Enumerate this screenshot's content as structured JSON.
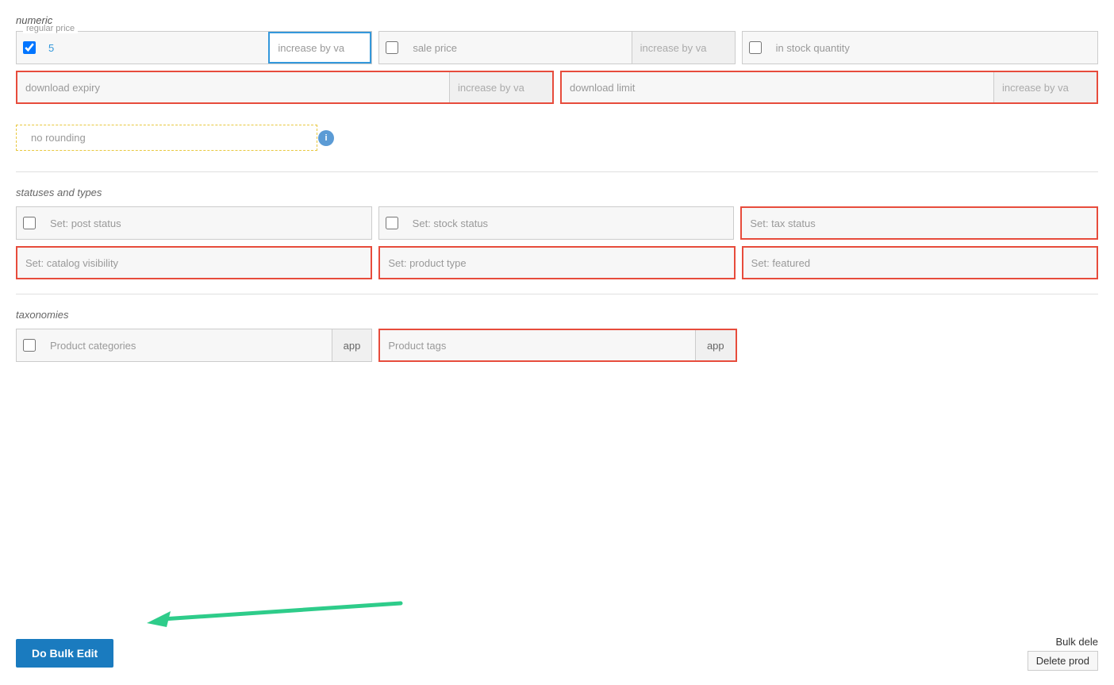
{
  "sections": {
    "numeric": {
      "label": "numeric",
      "rows": [
        {
          "cells": [
            {
              "id": "regular-price",
              "border": "normal",
              "hasCheckbox": true,
              "checked": true,
              "fieldLabel": "regular price",
              "inputValue": "5",
              "secondaryPlaceholder": "increase by va",
              "secondaryBlueBorder": true
            },
            {
              "id": "sale-price",
              "border": "normal",
              "hasCheckbox": true,
              "checked": false,
              "fieldLabel": "sale price",
              "inputValue": "",
              "secondaryPlaceholder": "increase by va",
              "secondaryBlueBorder": false
            },
            {
              "id": "in-stock-quantity",
              "border": "normal",
              "hasCheckbox": true,
              "checked": false,
              "fieldLabel": "in stock quantity",
              "inputValue": "",
              "secondaryPlaceholder": "",
              "secondaryBlueBorder": false,
              "noSecondary": true
            }
          ]
        },
        {
          "cells": [
            {
              "id": "download-expiry",
              "border": "red",
              "hasCheckbox": false,
              "fieldLabel": "download expiry",
              "secondaryPlaceholder": "increase by va"
            },
            {
              "id": "download-limit",
              "border": "red",
              "hasCheckbox": false,
              "fieldLabel": "download limit",
              "secondaryPlaceholder": "increase by va"
            }
          ]
        }
      ],
      "rounding": {
        "label": "no rounding",
        "infoIcon": "i"
      }
    },
    "statuses": {
      "label": "statuses and types",
      "rows": [
        {
          "cells": [
            {
              "id": "post-status",
              "border": "normal",
              "hasCheckbox": true,
              "checked": false,
              "fieldLabel": "Set: post status"
            },
            {
              "id": "stock-status",
              "border": "normal",
              "hasCheckbox": true,
              "checked": false,
              "fieldLabel": "Set: stock status"
            },
            {
              "id": "tax-status",
              "border": "red",
              "hasCheckbox": false,
              "fieldLabel": "Set: tax status"
            }
          ]
        },
        {
          "cells": [
            {
              "id": "catalog-visibility",
              "border": "red",
              "hasCheckbox": false,
              "fieldLabel": "Set: catalog visibility"
            },
            {
              "id": "product-type",
              "border": "red",
              "hasCheckbox": false,
              "fieldLabel": "Set: product type"
            },
            {
              "id": "set-featured",
              "border": "red",
              "hasCheckbox": false,
              "fieldLabel": "Set: featured"
            }
          ]
        }
      ]
    },
    "taxonomies": {
      "label": "taxonomies",
      "rows": [
        {
          "cells": [
            {
              "id": "product-categories",
              "border": "normal",
              "hasCheckbox": true,
              "checked": false,
              "fieldLabel": "Product categories",
              "hasAppBtn": true,
              "appBtnLabel": "app"
            },
            {
              "id": "product-tags",
              "border": "red",
              "hasCheckbox": false,
              "fieldLabel": "Product tags",
              "hasAppBtn": true,
              "appBtnLabel": "app"
            }
          ]
        }
      ]
    }
  },
  "buttons": {
    "doBulkEdit": "Do Bulk Edit",
    "bulkDelete": "Bulk dele",
    "deleteProduct": "Delete prod"
  }
}
